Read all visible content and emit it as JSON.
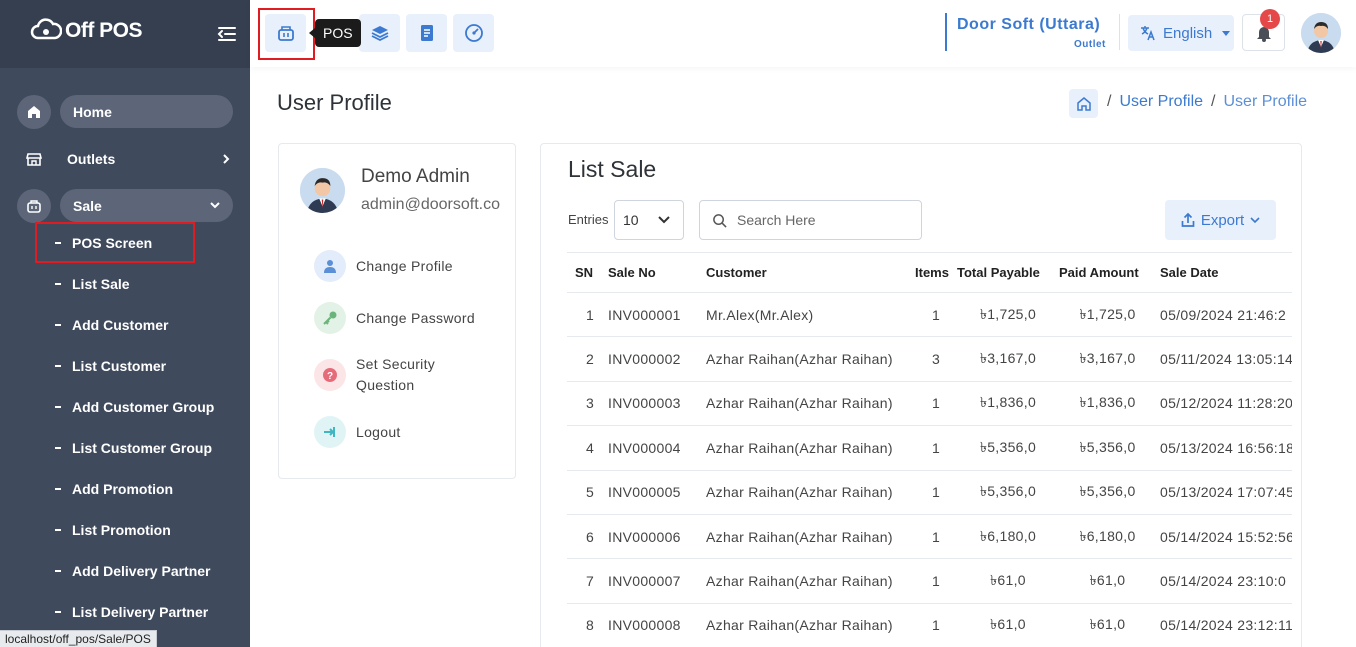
{
  "brand": {
    "name": "Off POS"
  },
  "sidebar": {
    "home": "Home",
    "outlets": "Outlets",
    "sale": "Sale",
    "sub_items": [
      "POS Screen",
      "List Sale",
      "Add Customer",
      "List Customer",
      "Add Customer Group",
      "List Customer Group",
      "Add Promotion",
      "List Promotion",
      "Add Delivery Partner",
      "List Delivery Partner"
    ]
  },
  "status_url": "localhost/off_pos/Sale/POS",
  "topbar": {
    "tooltip": "POS",
    "outlet_name": "Door Soft (Uttara)",
    "outlet_label": "Outlet",
    "language": "English",
    "notification_count": "1"
  },
  "page": {
    "title": "User Profile",
    "breadcrumb": [
      "User Profile",
      "User Profile"
    ]
  },
  "profile": {
    "name": "Demo Admin",
    "email": "admin@doorsoft.co",
    "menu": [
      "Change Profile",
      "Change Password",
      "Set Security Question",
      "Logout"
    ]
  },
  "list_sale": {
    "title": "List Sale",
    "entries_label": "Entries",
    "entries_value": "10",
    "search_placeholder": "Search Here",
    "export_label": "Export",
    "columns": [
      "SN",
      "Sale No",
      "Customer",
      "Items",
      "Total Payable",
      "Paid Amount",
      "Sale Date"
    ],
    "rows": [
      [
        "1",
        "INV000001",
        "Mr.Alex(Mr.Alex)",
        "1",
        "৳1,725,0",
        "৳1,725,0",
        "05/09/2024 21:46:2"
      ],
      [
        "2",
        "INV000002",
        "Azhar Raihan(Azhar Raihan)",
        "3",
        "৳3,167,0",
        "৳3,167,0",
        "05/11/2024 13:05:14"
      ],
      [
        "3",
        "INV000003",
        "Azhar Raihan(Azhar Raihan)",
        "1",
        "৳1,836,0",
        "৳1,836,0",
        "05/12/2024 11:28:20"
      ],
      [
        "4",
        "INV000004",
        "Azhar Raihan(Azhar Raihan)",
        "1",
        "৳5,356,0",
        "৳5,356,0",
        "05/13/2024 16:56:18"
      ],
      [
        "5",
        "INV000005",
        "Azhar Raihan(Azhar Raihan)",
        "1",
        "৳5,356,0",
        "৳5,356,0",
        "05/13/2024 17:07:45"
      ],
      [
        "6",
        "INV000006",
        "Azhar Raihan(Azhar Raihan)",
        "1",
        "৳6,180,0",
        "৳6,180,0",
        "05/14/2024 15:52:56"
      ],
      [
        "7",
        "INV000007",
        "Azhar Raihan(Azhar Raihan)",
        "1",
        "৳61,0",
        "৳61,0",
        "05/14/2024 23:10:0"
      ],
      [
        "8",
        "INV000008",
        "Azhar Raihan(Azhar Raihan)",
        "1",
        "৳61,0",
        "৳61,0",
        "05/14/2024 23:12:11"
      ]
    ]
  },
  "colors": {
    "sidebar_bg": "#3f4a5c",
    "brand_bg": "#353f50",
    "accent": "#3b7ad0",
    "highlight_box": "#e11b22"
  }
}
